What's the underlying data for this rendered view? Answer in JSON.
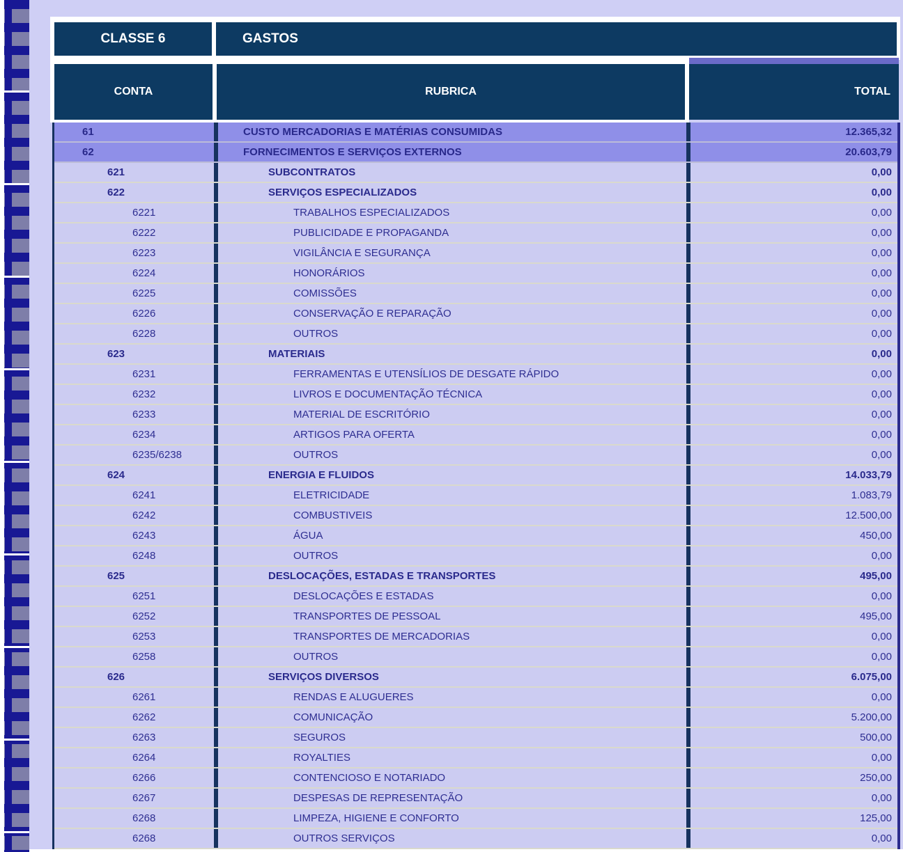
{
  "header": {
    "class_code": "CLASSE 6",
    "class_name": "GASTOS"
  },
  "table": {
    "columns": [
      {
        "key": "conta",
        "label": "CONTA"
      },
      {
        "key": "rubrica",
        "label": "RUBRICA"
      },
      {
        "key": "total",
        "label": "TOTAL"
      }
    ],
    "rows": [
      {
        "conta": "61",
        "rubrica": "CUSTO MERCADORIAS E MATÉRIAS CONSUMIDAS",
        "total": "12.365,32",
        "level": 2
      },
      {
        "conta": "62",
        "rubrica": "FORNECIMENTOS E SERVIÇOS EXTERNOS",
        "total": "20.603,79",
        "level": 2
      },
      {
        "conta": "621",
        "rubrica": "SUBCONTRATOS",
        "total": "0,00",
        "level": 3
      },
      {
        "conta": "622",
        "rubrica": "SERVIÇOS ESPECIALIZADOS",
        "total": "0,00",
        "level": 3
      },
      {
        "conta": "6221",
        "rubrica": "TRABALHOS ESPECIALIZADOS",
        "total": "0,00",
        "level": 4
      },
      {
        "conta": "6222",
        "rubrica": "PUBLICIDADE E PROPAGANDA",
        "total": "0,00",
        "level": 4
      },
      {
        "conta": "6223",
        "rubrica": "VIGILÂNCIA E SEGURANÇA",
        "total": "0,00",
        "level": 4
      },
      {
        "conta": "6224",
        "rubrica": "HONORÁRIOS",
        "total": "0,00",
        "level": 4
      },
      {
        "conta": "6225",
        "rubrica": "COMISSÕES",
        "total": "0,00",
        "level": 4
      },
      {
        "conta": "6226",
        "rubrica": "CONSERVAÇÃO E REPARAÇÃO",
        "total": "0,00",
        "level": 4
      },
      {
        "conta": "6228",
        "rubrica": "OUTROS",
        "total": "0,00",
        "level": 4
      },
      {
        "conta": "623",
        "rubrica": "MATERIAIS",
        "total": "0,00",
        "level": 3
      },
      {
        "conta": "6231",
        "rubrica": "FERRAMENTAS E UTENSÍLIOS DE DESGATE RÁPIDO",
        "total": "0,00",
        "level": 4
      },
      {
        "conta": "6232",
        "rubrica": "LIVROS E DOCUMENTAÇÃO TÉCNICA",
        "total": "0,00",
        "level": 4
      },
      {
        "conta": "6233",
        "rubrica": "MATERIAL DE ESCRITÓRIO",
        "total": "0,00",
        "level": 4
      },
      {
        "conta": "6234",
        "rubrica": "ARTIGOS PARA OFERTA",
        "total": "0,00",
        "level": 4
      },
      {
        "conta": "6235/6238",
        "rubrica": "OUTROS",
        "total": "0,00",
        "level": 4
      },
      {
        "conta": "624",
        "rubrica": "ENERGIA E FLUIDOS",
        "total": "14.033,79",
        "level": 3
      },
      {
        "conta": "6241",
        "rubrica": "ELETRICIDADE",
        "total": "1.083,79",
        "level": 4
      },
      {
        "conta": "6242",
        "rubrica": "COMBUSTIVEIS",
        "total": "12.500,00",
        "level": 4
      },
      {
        "conta": "6243",
        "rubrica": "ÁGUA",
        "total": "450,00",
        "level": 4
      },
      {
        "conta": "6248",
        "rubrica": "OUTROS",
        "total": "0,00",
        "level": 4
      },
      {
        "conta": "625",
        "rubrica": "DESLOCAÇÕES, ESTADAS E TRANSPORTES",
        "total": "495,00",
        "level": 3
      },
      {
        "conta": "6251",
        "rubrica": "DESLOCAÇÕES E ESTADAS",
        "total": "0,00",
        "level": 4
      },
      {
        "conta": "6252",
        "rubrica": "TRANSPORTES DE PESSOAL",
        "total": "495,00",
        "level": 4
      },
      {
        "conta": "6253",
        "rubrica": "TRANSPORTES DE MERCADORIAS",
        "total": "0,00",
        "level": 4
      },
      {
        "conta": "6258",
        "rubrica": "OUTROS",
        "total": "0,00",
        "level": 4
      },
      {
        "conta": "626",
        "rubrica": "SERVIÇOS DIVERSOS",
        "total": "6.075,00",
        "level": 3
      },
      {
        "conta": "6261",
        "rubrica": "RENDAS E ALUGUERES",
        "total": "0,00",
        "level": 4
      },
      {
        "conta": "6262",
        "rubrica": "COMUNICAÇÃO",
        "total": "5.200,00",
        "level": 4
      },
      {
        "conta": "6263",
        "rubrica": "SEGUROS",
        "total": "500,00",
        "level": 4
      },
      {
        "conta": "6264",
        "rubrica": "ROYALTIES",
        "total": "0,00",
        "level": 4
      },
      {
        "conta": "6266",
        "rubrica": "CONTENCIOSO E NOTARIADO",
        "total": "250,00",
        "level": 4
      },
      {
        "conta": "6267",
        "rubrica": "DESPESAS DE REPRESENTAÇÃO",
        "total": "0,00",
        "level": 4
      },
      {
        "conta": "6268",
        "rubrica": "LIMPEZA, HIGIENE E CONFORTO",
        "total": "125,00",
        "level": 4
      },
      {
        "conta": "6268",
        "rubrica": "OUTROS SERVIÇOS",
        "total": "0,00",
        "level": 4
      }
    ]
  },
  "colors": {
    "page_background": "#cfcff5",
    "header_navy": "#0d3a62",
    "total_header_top_stripe": "#6a6ac8",
    "row_level2_background": "#8f8fe8",
    "row_light_background": "#ccccf2",
    "data_text_navy": "#2e2e91",
    "grid_divider_navy": "#16325f",
    "binder_strip_grey": "#7e7ea9",
    "binder_strip_navy": "#181894"
  }
}
